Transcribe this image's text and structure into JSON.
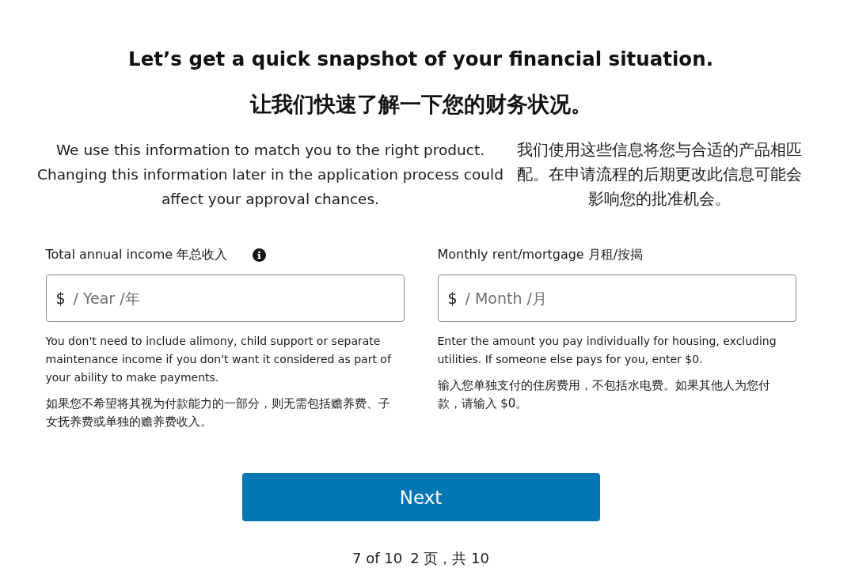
{
  "heading": {
    "title": "Let’s get a quick snapshot of your financial situation.",
    "title_zh": "让我们快速了解一下您的财务状况。"
  },
  "intro": {
    "text": "We use this information to match you to the right product. Changing this information later in the application process could affect your approval chances.",
    "text_zh": "我们使用这些信息将您与合适的产品相匹配。在申请流程的后期更改此信息可能会影响您的批准机会。"
  },
  "fields": [
    {
      "label": "Total annual income 年总收入",
      "info": true,
      "prefix": "$",
      "placeholder": "/ Year /年",
      "help": [
        "You don't need to include alimony, child support or separate maintenance income if you don't want it considered as part of your ability to make payments.",
        "如果您不希望将其视为付款能力的一部分，则无需包括赡养费、子女抚养费或单独的赡养费收入。"
      ]
    },
    {
      "label": "Monthly rent/mortgage 月租/按揭",
      "info": false,
      "prefix": "$",
      "placeholder": "/ Month /月",
      "help": [
        "Enter the amount you pay individually for housing, excluding utilities. If someone else pays for you, enter $0.",
        "输入您单独支付的住房费用，不包括水电费。如果其他人为您付款，请输入 $0。"
      ]
    }
  ],
  "next_button": "Next",
  "progress": [
    "7 of 10",
    "2 页，共 10"
  ]
}
